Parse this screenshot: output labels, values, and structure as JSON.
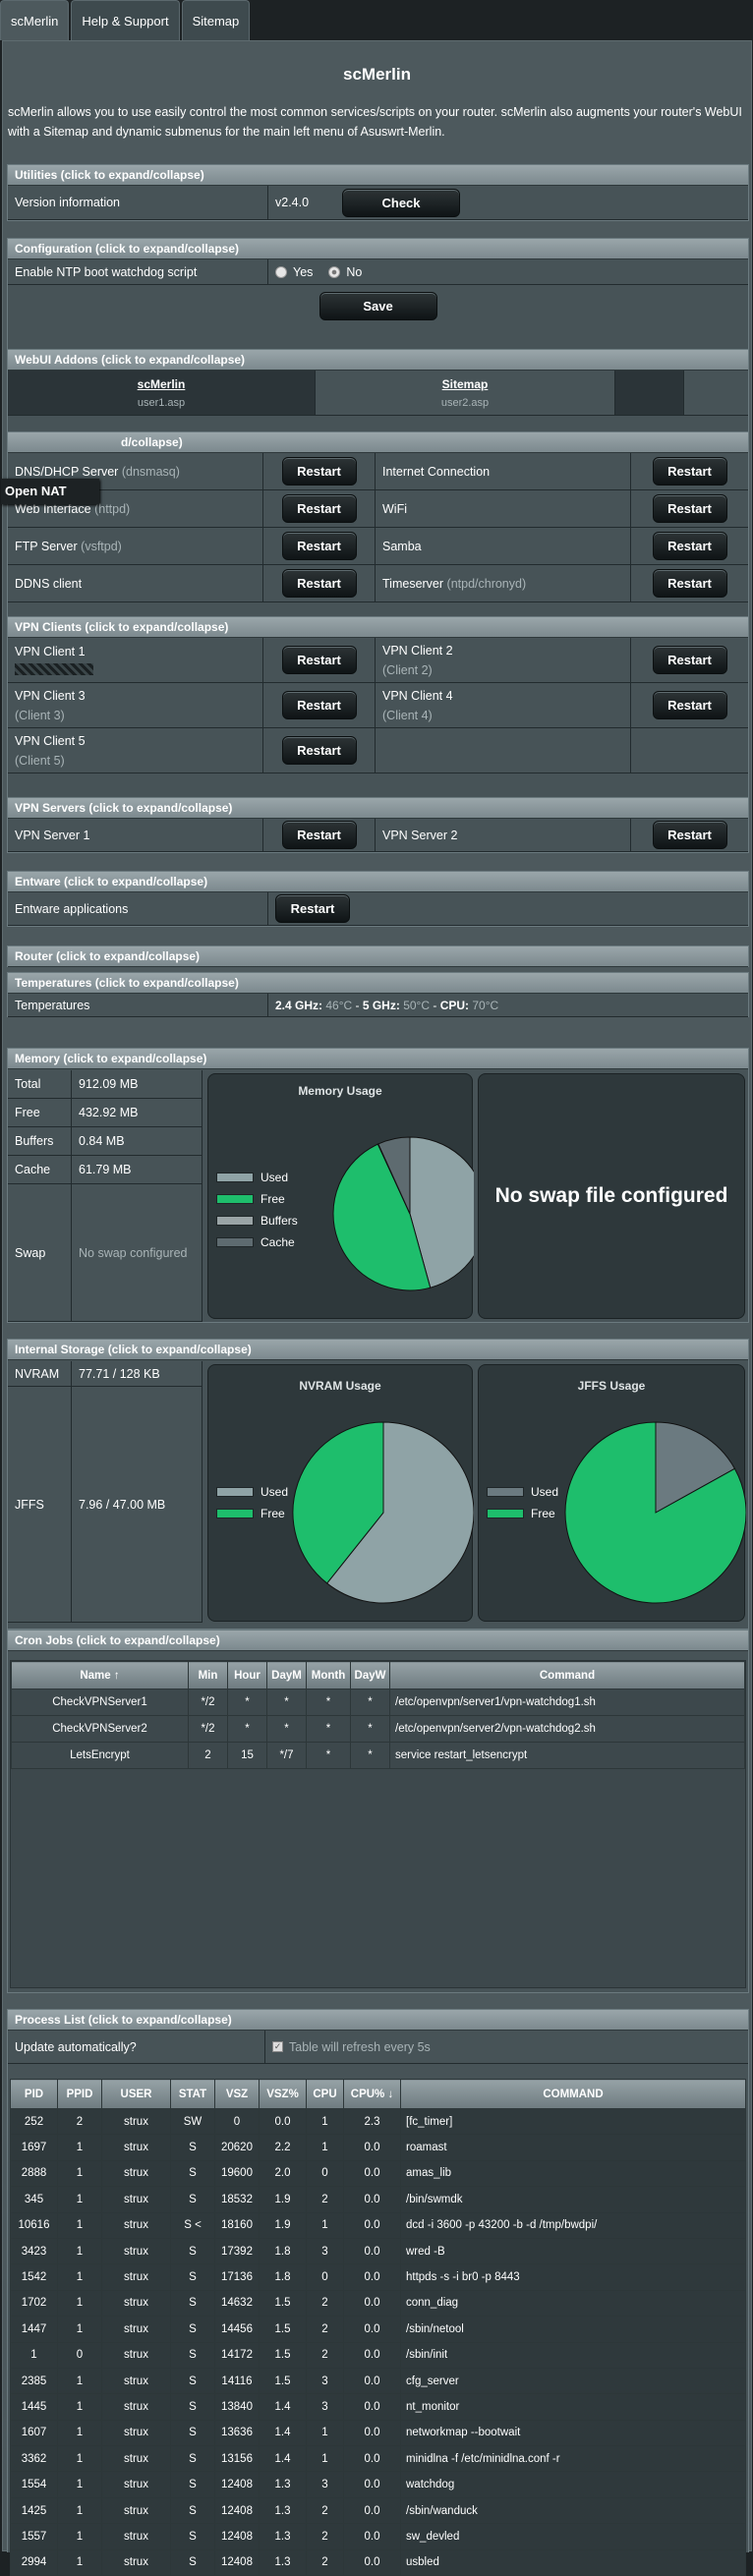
{
  "tabs": [
    "scMerlin",
    "Help & Support",
    "Sitemap"
  ],
  "title": "scMerlin",
  "description": "scMerlin allows you to use easily control the most common services/scripts on your router. scMerlin also augments your router's WebUI with a Sitemap and dynamic submenus for the main left menu of Asuswrt-Merlin.",
  "utilities": {
    "header": "Utilities (click to expand/collapse)",
    "version_label": "Version information",
    "version": "v2.4.0",
    "check": "Check"
  },
  "config": {
    "header": "Configuration (click to expand/collapse)",
    "ntp_label": "Enable NTP boot watchdog script",
    "yes": "Yes",
    "no": "No",
    "save": "Save"
  },
  "addons": {
    "header": "WebUI Addons (click to expand/collapse)",
    "items": [
      {
        "name": "scMerlin",
        "file": "user1.asp"
      },
      {
        "name": "Sitemap",
        "file": "user2.asp"
      }
    ]
  },
  "overlay": "Open NAT",
  "services": {
    "header_tail": "d/collapse)",
    "restart": "Restart",
    "rows": [
      [
        "DNS/DHCP Server",
        "(dnsmasq)",
        "Internet Connection",
        ""
      ],
      [
        "Web Interface",
        "(httpd)",
        "WiFi",
        ""
      ],
      [
        "FTP Server",
        "(vsftpd)",
        "Samba",
        ""
      ],
      [
        "DDNS client",
        "",
        "Timeserver",
        "(ntpd/chronyd)"
      ]
    ]
  },
  "vpn_clients": {
    "header": "VPN Clients (click to expand/collapse)",
    "items": [
      {
        "name": "VPN Client 1",
        "sub": ""
      },
      {
        "name": "VPN Client 2",
        "sub": "(Client 2)"
      },
      {
        "name": "VPN Client 3",
        "sub": "(Client 3)"
      },
      {
        "name": "VPN Client 4",
        "sub": "(Client 4)"
      },
      {
        "name": "VPN Client 5",
        "sub": "(Client 5)"
      }
    ]
  },
  "vpn_servers": {
    "header": "VPN Servers (click to expand/collapse)",
    "items": [
      "VPN Server 1",
      "VPN Server 2"
    ]
  },
  "entware": {
    "header": "Entware (click to expand/collapse)",
    "label": "Entware applications"
  },
  "router": {
    "header": "Router (click to expand/collapse)",
    "temps_header": "Temperatures (click to expand/collapse)",
    "temps_label": "Temperatures",
    "g24": "2.4 GHz:",
    "g24v": "46°C",
    "g5": "5 GHz:",
    "g5v": "50°C",
    "cpu": "CPU:",
    "cpuv": "70°C"
  },
  "memory": {
    "header": "Memory (click to expand/collapse)",
    "rows": [
      [
        "Total",
        "912.09 MB"
      ],
      [
        "Free",
        "432.92 MB"
      ],
      [
        "Buffers",
        "0.84 MB"
      ],
      [
        "Cache",
        "61.79 MB"
      ]
    ],
    "swap_label": "Swap",
    "swap_value": "No swap configured",
    "chart_title": "Memory Usage",
    "no_swap": "No swap file configured"
  },
  "storage": {
    "header": "Internal Storage (click to expand/collapse)",
    "nvram_label": "NVRAM",
    "nvram_value": "77.71 / 128 KB",
    "jffs_label": "JFFS",
    "jffs_value": "7.96 / 47.00 MB",
    "nvram_title": "NVRAM Usage",
    "jffs_title": "JFFS Usage"
  },
  "chart_data": [
    {
      "type": "pie",
      "title": "Memory Usage",
      "categories": [
        "Used",
        "Free",
        "Buffers",
        "Cache"
      ],
      "values": [
        417.33,
        432.92,
        0.84,
        61.79
      ],
      "colors": [
        "#8fa3a6",
        "#1ebe6c",
        "#9aa4a6",
        "#5e6b70"
      ]
    },
    {
      "type": "pie",
      "title": "NVRAM Usage",
      "categories": [
        "Used",
        "Free"
      ],
      "values": [
        77.71,
        50.29
      ],
      "colors": [
        "#8fa3a6",
        "#1ebe6c"
      ]
    },
    {
      "type": "pie",
      "title": "JFFS Usage",
      "categories": [
        "Used",
        "Free"
      ],
      "values": [
        7.96,
        39.04
      ],
      "colors": [
        "#6b7a80",
        "#1ebe6c"
      ]
    }
  ],
  "cron": {
    "header": "Cron Jobs (click to expand/collapse)",
    "cols": [
      "Name ↑",
      "Min",
      "Hour",
      "DayM",
      "Month",
      "DayW",
      "Command"
    ],
    "rows": [
      [
        "CheckVPNServer1",
        "*/2",
        "*",
        "*",
        "*",
        "*",
        "/etc/openvpn/server1/vpn-watchdog1.sh"
      ],
      [
        "CheckVPNServer2",
        "*/2",
        "*",
        "*",
        "*",
        "*",
        "/etc/openvpn/server2/vpn-watchdog2.sh"
      ],
      [
        "LetsEncrypt",
        "2",
        "15",
        "*/7",
        "*",
        "*",
        "service restart_letsencrypt"
      ]
    ]
  },
  "process": {
    "header": "Process List (click to expand/collapse)",
    "update_label": "Update automatically?",
    "refresh_note": "Table will refresh every 5s",
    "cols": [
      "PID",
      "PPID",
      "USER",
      "STAT",
      "VSZ",
      "VSZ%",
      "CPU",
      "CPU% ↓",
      "COMMAND"
    ],
    "rows": [
      [
        "252",
        "2",
        "strux",
        "SW",
        "0",
        "0.0",
        "1",
        "2.3",
        "[fc_timer]"
      ],
      [
        "1697",
        "1",
        "strux",
        "S",
        "20620",
        "2.2",
        "1",
        "0.0",
        "roamast"
      ],
      [
        "2888",
        "1",
        "strux",
        "S",
        "19600",
        "2.0",
        "0",
        "0.0",
        "amas_lib"
      ],
      [
        "345",
        "1",
        "strux",
        "S",
        "18532",
        "1.9",
        "2",
        "0.0",
        "/bin/swmdk"
      ],
      [
        "10616",
        "1",
        "strux",
        "S <",
        "18160",
        "1.9",
        "1",
        "0.0",
        "dcd -i 3600 -p 43200 -b -d /tmp/bwdpi/"
      ],
      [
        "3423",
        "1",
        "strux",
        "S",
        "17392",
        "1.8",
        "3",
        "0.0",
        "wred -B"
      ],
      [
        "1542",
        "1",
        "strux",
        "S",
        "17136",
        "1.8",
        "0",
        "0.0",
        "httpds -s -i br0 -p 8443"
      ],
      [
        "1702",
        "1",
        "strux",
        "S",
        "14632",
        "1.5",
        "2",
        "0.0",
        "conn_diag"
      ],
      [
        "1447",
        "1",
        "strux",
        "S",
        "14456",
        "1.5",
        "2",
        "0.0",
        "/sbin/netool"
      ],
      [
        "1",
        "0",
        "strux",
        "S",
        "14172",
        "1.5",
        "2",
        "0.0",
        "/sbin/init"
      ],
      [
        "2385",
        "1",
        "strux",
        "S",
        "14116",
        "1.5",
        "3",
        "0.0",
        "cfg_server"
      ],
      [
        "1445",
        "1",
        "strux",
        "S",
        "13840",
        "1.4",
        "3",
        "0.0",
        "nt_monitor"
      ],
      [
        "1607",
        "1",
        "strux",
        "S",
        "13636",
        "1.4",
        "1",
        "0.0",
        "networkmap --bootwait"
      ],
      [
        "3362",
        "1",
        "strux",
        "S",
        "13156",
        "1.4",
        "1",
        "0.0",
        "minidlna -f /etc/minidlna.conf -r"
      ],
      [
        "1554",
        "1",
        "strux",
        "S",
        "12408",
        "1.3",
        "3",
        "0.0",
        "watchdog"
      ],
      [
        "1425",
        "1",
        "strux",
        "S",
        "12408",
        "1.3",
        "2",
        "0.0",
        "/sbin/wanduck"
      ],
      [
        "1557",
        "1",
        "strux",
        "S",
        "12408",
        "1.3",
        "2",
        "0.0",
        "sw_devled"
      ],
      [
        "2994",
        "1",
        "strux",
        "S",
        "12408",
        "1.3",
        "2",
        "0.0",
        "usbled"
      ]
    ]
  }
}
